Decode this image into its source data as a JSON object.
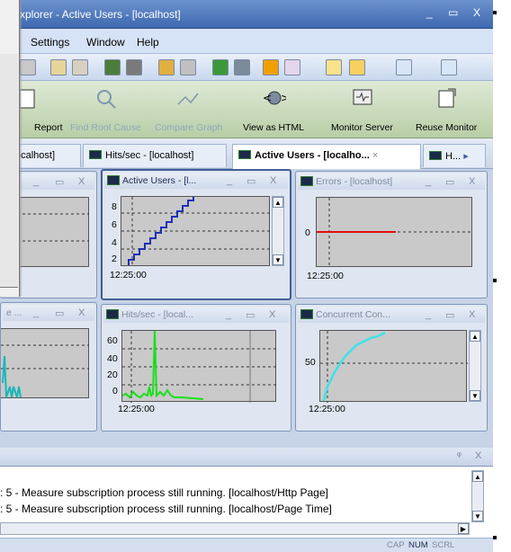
{
  "window": {
    "title": "e Explorer - Active Users - [localhost]",
    "min": "_",
    "max": "▭",
    "close": "X"
  },
  "menu": [
    "Settings",
    "Window",
    "Help"
  ],
  "toolbar_big": [
    {
      "label": "Report",
      "dim": false
    },
    {
      "label": "Find Root Cause",
      "dim": true
    },
    {
      "label": "Compare Graph",
      "dim": true
    },
    {
      "label": "View as HTML",
      "dim": false
    },
    {
      "label": "Monitor Server",
      "dim": false
    },
    {
      "label": "Reuse Monitor",
      "dim": false
    }
  ],
  "tabs": [
    {
      "label": "ocalhost]"
    },
    {
      "label": "Hits/sec - [localhost]"
    },
    {
      "label": "Active Users - [localho...",
      "close": "×"
    },
    {
      "label": "H...",
      "more": "▸"
    }
  ],
  "graphs": [
    {
      "title": "",
      "left_panel": true
    },
    {
      "title": "Active Users - [l...",
      "yticks": [
        "8",
        "6",
        "4",
        "2"
      ],
      "time": "12:25:00"
    },
    {
      "title": "Errors - [localhost]",
      "yticks": [
        "0"
      ],
      "time": "12:25:00"
    },
    {
      "title": "e ...",
      "yticks": [],
      "time": ""
    },
    {
      "title": "Hits/sec - [local...",
      "yticks": [
        "60",
        "40",
        "20",
        "0"
      ],
      "time": "12:25:00"
    },
    {
      "title": "Concurrent Con...",
      "yticks": [
        "50"
      ],
      "time": "12:25:00"
    }
  ],
  "window_controls": {
    "min": "_",
    "max": "▭",
    "close": "X"
  },
  "output": {
    "pin": "ᵠ",
    "close": "X",
    "lines": [
      ": 5 - Measure subscription process still running. [localhost/Http Page]",
      ": 5 - Measure subscription process still running. [localhost/Page Time]"
    ]
  },
  "status": [
    "CAP",
    "NUM",
    "SCRL"
  ],
  "colors": {
    "active_users": "#1f2fb5",
    "errors": "#e01010",
    "hits": "#18e018",
    "concurrent": "#3ee0e6"
  }
}
